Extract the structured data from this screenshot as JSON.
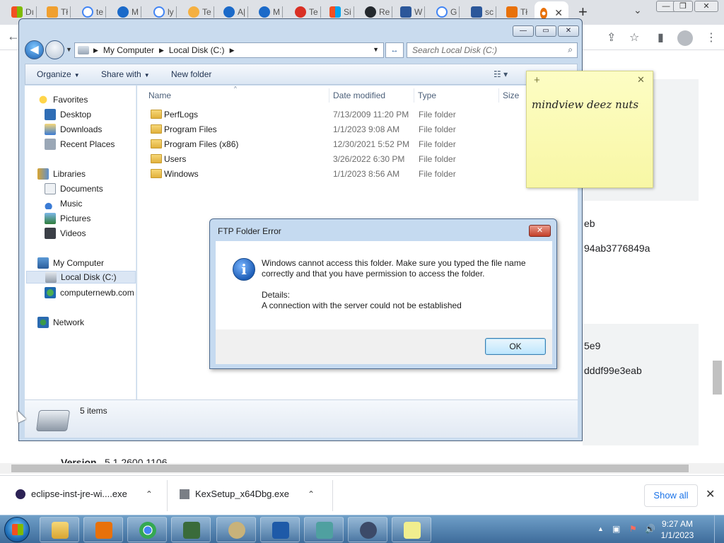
{
  "browser": {
    "tabs": [
      {
        "label": "Dı",
        "color": "#f25022"
      },
      {
        "label": "Tł",
        "color": "#f0a030"
      },
      {
        "label": "te",
        "color": "#4285f4"
      },
      {
        "label": "M",
        "color": "#1b6ac9"
      },
      {
        "label": "ly",
        "color": "#4285f4"
      },
      {
        "label": "Te",
        "color": "#f5b041"
      },
      {
        "label": "A|",
        "color": "#1b6ac9"
      },
      {
        "label": "M",
        "color": "#1b6ac9"
      },
      {
        "label": "Te",
        "color": "#d93025"
      },
      {
        "label": "Si",
        "color": "#f25022"
      },
      {
        "label": "Re",
        "color": "#24292e"
      },
      {
        "label": "W",
        "color": "#2b579a"
      },
      {
        "label": "G",
        "color": "#4285f4"
      },
      {
        "label": "sc",
        "color": "#2b579a"
      },
      {
        "label": "Tł",
        "color": "#e8710a"
      }
    ],
    "active_tab_close": "✕",
    "new_tab": "+",
    "tab_search": "⌄",
    "win_min": "—",
    "win_max": "❐",
    "win_close": "✕",
    "back_arrow": "←",
    "page": {
      "line1": "eb",
      "line2": "94ab3776849a",
      "line3": "5e9",
      "line4": "dddf99e3eab",
      "version_label": "Version",
      "version_value": "5.1.2600.1106"
    }
  },
  "downloads": {
    "items": [
      {
        "name": "eclipse-inst-jre-wi....exe",
        "chevron": "⌃"
      },
      {
        "name": "KexSetup_x64Dbg.exe",
        "chevron": "⌃"
      }
    ],
    "show_all": "Show all",
    "close": "✕"
  },
  "explorer": {
    "caption": {
      "min": "—",
      "max": "▭",
      "close": "✕"
    },
    "back": "◀",
    "breadcrumb": [
      "My Computer",
      "Local Disk (C:)"
    ],
    "crumb_sep": "▶",
    "refresh": "↔",
    "search_placeholder": "Search Local Disk (C:)",
    "search_icon": "⌕",
    "commands": {
      "organize": "Organize",
      "share": "Share with",
      "new_folder": "New folder",
      "dropdown": "▼",
      "view": "☷ ▾"
    },
    "nav": {
      "favorites": "Favorites",
      "desktop": "Desktop",
      "downloads": "Downloads",
      "recent": "Recent Places",
      "libraries": "Libraries",
      "documents": "Documents",
      "music": "Music",
      "pictures": "Pictures",
      "videos": "Videos",
      "my_computer": "My Computer",
      "local_disk": "Local Disk (C:)",
      "ftp_site": "computernewb.com",
      "network": "Network"
    },
    "columns": {
      "name": "Name",
      "date": "Date modified",
      "type": "Type",
      "size": "Size",
      "sort": "^"
    },
    "files": [
      {
        "name": "PerfLogs",
        "date": "7/13/2009 11:20 PM",
        "type": "File folder"
      },
      {
        "name": "Program Files",
        "date": "1/1/2023 9:08 AM",
        "type": "File folder"
      },
      {
        "name": "Program Files (x86)",
        "date": "12/30/2021 5:52 PM",
        "type": "File folder"
      },
      {
        "name": "Users",
        "date": "3/26/2022 6:30 PM",
        "type": "File folder"
      },
      {
        "name": "Windows",
        "date": "1/1/2023 8:56 AM",
        "type": "File folder"
      }
    ],
    "status_count": "5 items"
  },
  "dialog": {
    "title": "FTP Folder Error",
    "close": "✕",
    "info_glyph": "i",
    "message_line1": "Windows cannot access this folder. Make sure you typed the file name",
    "message_line2": "correctly and that you have permission to access the folder.",
    "details_label": "Details:",
    "details_text": "A connection with the server could not be established",
    "ok": "OK"
  },
  "sticky": {
    "plus": "+",
    "close": "✕",
    "text": "mindview deez nuts"
  },
  "taskbar": {
    "time": "9:27 AM",
    "date": "1/1/2023",
    "tray_up": "▲",
    "volume": "🔊"
  }
}
